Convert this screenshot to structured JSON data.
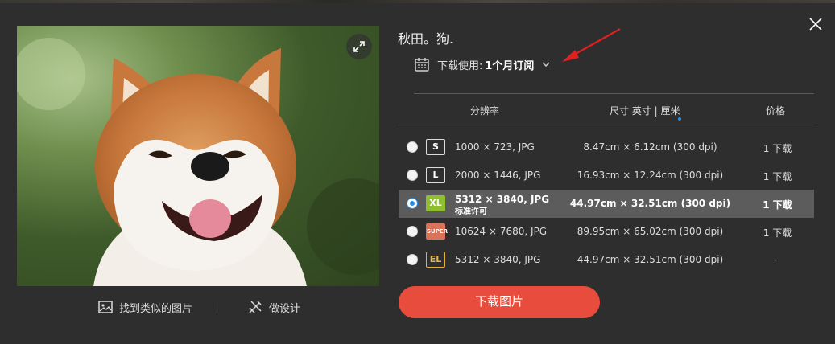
{
  "photo": {
    "alt_subject": "dog"
  },
  "actions": {
    "find_similar": "找到类似的图片",
    "design": "做设计"
  },
  "info": {
    "title": "秋田。狗.",
    "license_label": "下载使用:",
    "license_value": "1个月订阅"
  },
  "table": {
    "headers": {
      "resolution": "分辨率",
      "size": "尺寸 英寸 | 厘米",
      "price": "价格"
    },
    "rows": [
      {
        "badge": "S",
        "resolution": "1000 × 723, JPG",
        "sublabel": "",
        "dims": "8.47cm × 6.12cm (300 dpi)",
        "price": "1 下载",
        "selected": false
      },
      {
        "badge": "L",
        "resolution": "2000 × 1446, JPG",
        "sublabel": "",
        "dims": "16.93cm × 12.24cm (300 dpi)",
        "price": "1 下载",
        "selected": false
      },
      {
        "badge": "XL",
        "resolution": "5312 × 3840, JPG",
        "sublabel": "标准许可",
        "dims": "44.97cm × 32.51cm (300 dpi)",
        "price": "1 下载",
        "selected": true
      },
      {
        "badge": "SUPER",
        "resolution": "10624 × 7680, JPG",
        "sublabel": "",
        "dims": "89.95cm × 65.02cm (300 dpi)",
        "price": "1 下载",
        "selected": false
      },
      {
        "badge": "EL",
        "resolution": "5312 × 3840, JPG",
        "sublabel": "",
        "dims": "44.97cm × 32.51cm (300 dpi)",
        "price": "-",
        "selected": false
      }
    ]
  },
  "download_button": "下载图片",
  "colors": {
    "background": "#2e2e2e",
    "accent_button": "#e84c3d",
    "selected_row": "#5c5c5c",
    "radio_selected": "#2a8de0",
    "badge_xl": "#8fbf2f",
    "badge_super": "#d9735a",
    "badge_el": "#e2b13a",
    "annotation_arrow": "#e02020"
  },
  "icons": {
    "expand": "expand-arrows-icon",
    "close": "close-x-icon",
    "calendar": "calendar-icon",
    "chevron": "chevron-down-icon",
    "image": "image-icon",
    "design": "brush-ruler-icon"
  }
}
